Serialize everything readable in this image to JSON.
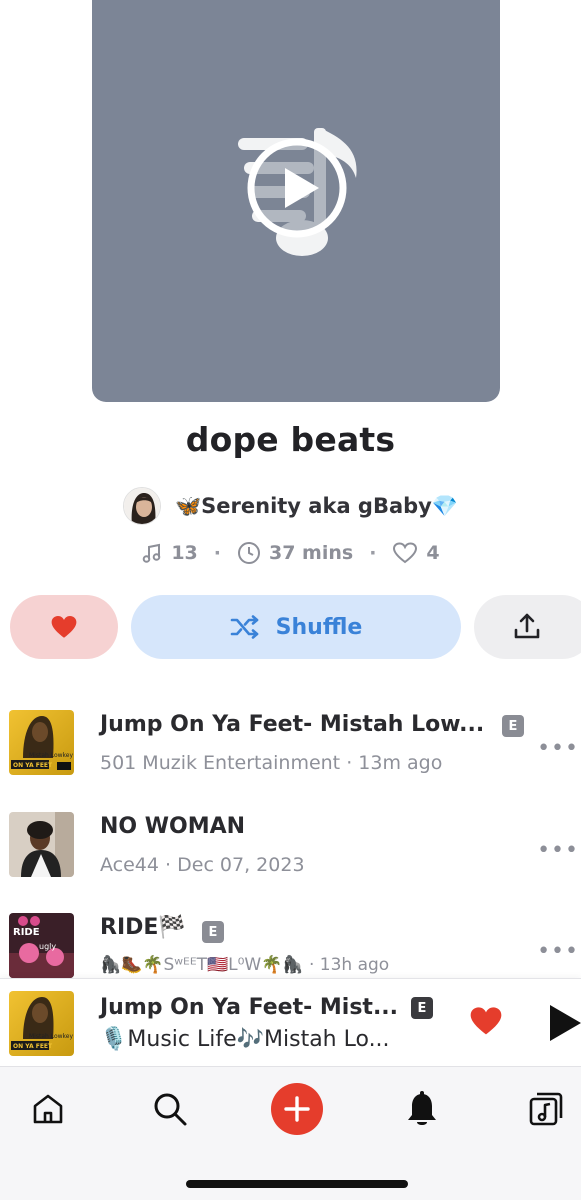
{
  "playlist": {
    "title": "dope beats",
    "owner": "🦋Serenity aka gBaby💎",
    "track_count": "13",
    "duration": "37 mins",
    "likes": "4"
  },
  "actions": {
    "shuffle_label": "Shuffle"
  },
  "tracks": [
    {
      "title": "Jump On Ya Feet- Mistah Low...",
      "explicit": "E",
      "artist": "501 Muzik Entertainment",
      "time": "13m ago"
    },
    {
      "title": "NO WOMAN",
      "artist": "Ace44",
      "time": "Dec 07, 2023"
    },
    {
      "title": "RIDE🏁",
      "explicit": "E",
      "artist": "🦍🥾🌴SʷᴱᴱT🇺🇸L⁰W🌴🦍",
      "time": "13h ago"
    }
  ],
  "now_playing": {
    "title": "Jump On Ya Feet- Mist...",
    "explicit": "E",
    "artist": "🎙️Music Life🎶Mistah Lo..."
  },
  "thumb_text": {
    "artist_line": "Mistah Lowkey",
    "song_line": "ON YA FEET",
    "ride_line": "RIDE",
    "ugly_line": "ugly"
  },
  "colors": {
    "accent_red": "#e53d2c",
    "shuffle_blue": "#3a82d8",
    "cover_gray": "#7c8596"
  },
  "icons": {
    "cover": "music-note-play-icon",
    "tracks": "music-note-icon",
    "clock": "clock-icon",
    "heart": "heart-outline-icon",
    "shuffle": "shuffle-icon",
    "share": "share-icon",
    "more": "more-icon",
    "home": "home-icon",
    "search": "search-icon",
    "add": "plus-icon",
    "notifications": "bell-icon",
    "library": "library-icon"
  }
}
